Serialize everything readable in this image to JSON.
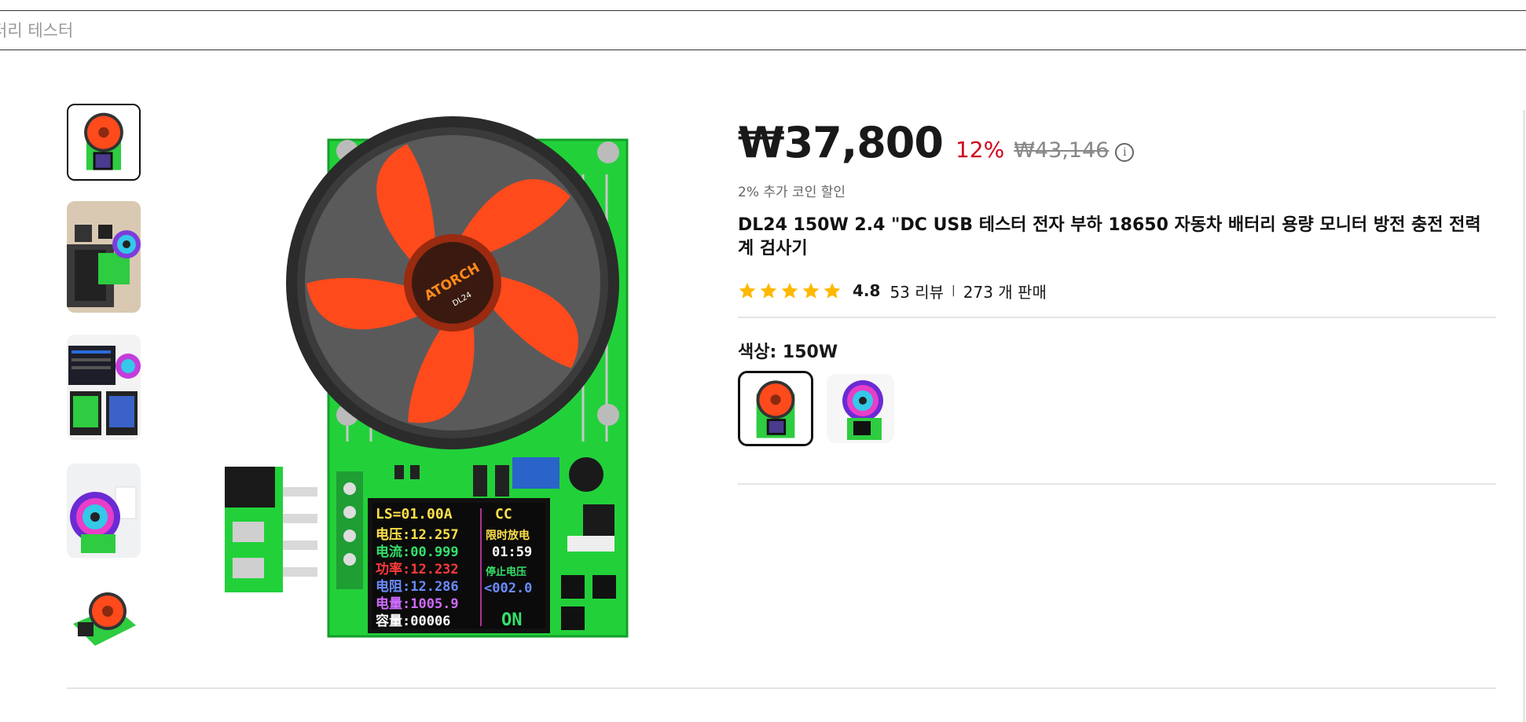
{
  "search": {
    "placeholder": "터리 테스터"
  },
  "gallery": {
    "thumbnails": [
      {
        "label": "thumbnail-1",
        "selected": true
      },
      {
        "label": "thumbnail-2",
        "selected": false
      },
      {
        "label": "thumbnail-3",
        "selected": false
      },
      {
        "label": "thumbnail-4",
        "selected": false
      },
      {
        "label": "thumbnail-5",
        "selected": false
      }
    ]
  },
  "product": {
    "price": "₩37,800",
    "discount": "12%",
    "original_price": "₩43,146",
    "coin_note": "2% 추가 코인 할인",
    "title": "DL24 150W 2.4 \"DC USB 테스터 전자 부하 18650 자동차 배터리 용량 모니터 방전 충전 전력계 검사기",
    "rating": "4.8",
    "reviews": "53 리뷰",
    "sold": "273 개 판매",
    "star_count": 5,
    "color_label": "색상: 150W",
    "image_text": {
      "brand": "ATORCH",
      "model": "DL24",
      "screen_lines": [
        "LS=01.00A",
        "CC",
        "电压:12.257",
        "电流:00.999",
        "功率:12.232",
        "电阻:12.286",
        "电量:1005.9",
        "容量:00006",
        "限时放电",
        "01:59",
        "停止电压",
        "<002.0",
        "ON"
      ]
    }
  },
  "colors": {
    "accent_red": "#d0021b",
    "star": "#ffb800",
    "text": "#191919",
    "muted": "#666666"
  }
}
